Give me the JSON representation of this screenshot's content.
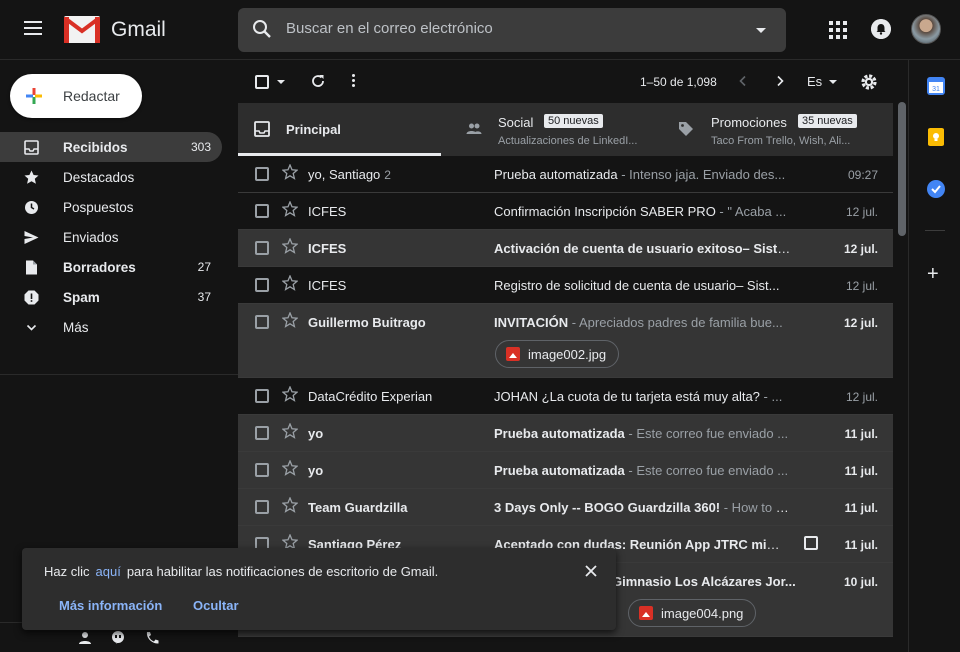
{
  "app": {
    "name": "Gmail"
  },
  "search": {
    "placeholder": "Buscar en el correo electrónico"
  },
  "compose": {
    "label": "Redactar"
  },
  "sidebar": {
    "items": [
      {
        "label": "Recibidos",
        "count": "303",
        "icon": "inbox-icon"
      },
      {
        "label": "Destacados",
        "count": "",
        "icon": "star-icon"
      },
      {
        "label": "Pospuestos",
        "count": "",
        "icon": "clock-icon"
      },
      {
        "label": "Enviados",
        "count": "",
        "icon": "send-icon"
      },
      {
        "label": "Borradores",
        "count": "27",
        "icon": "file-icon"
      },
      {
        "label": "Spam",
        "count": "37",
        "icon": "spam-icon"
      },
      {
        "label": "Más",
        "count": "",
        "icon": "chevron-down-icon"
      }
    ]
  },
  "toolbar": {
    "pager": "1–50 de 1,098",
    "lang": "Es"
  },
  "tabs": {
    "principal": {
      "label": "Principal"
    },
    "social": {
      "label": "Social",
      "badge": "50 nuevas",
      "sub": "Actualizaciones de LinkedI..."
    },
    "promos": {
      "label": "Promociones",
      "badge": "35 nuevas",
      "sub": "Taco From Trello, Wish, Ali..."
    }
  },
  "emails": [
    {
      "sender": "yo, Santiago",
      "count": "2",
      "subject": "Prueba automatizada",
      "snippet": " - Intenso jaja. Enviado des...",
      "date": "09:27"
    },
    {
      "sender": "ICFES",
      "subject": "Confirmación Inscripción SABER PRO",
      "snippet": " - \" Acaba ...",
      "date": "12 jul."
    },
    {
      "sender": "ICFES",
      "subject": "Activación de cuenta de usuario exitoso– Siste...",
      "snippet": "",
      "date": "12 jul."
    },
    {
      "sender": "ICFES",
      "subject": "Registro de solicitud de cuenta de usuario– Sist...",
      "snippet": "",
      "date": "12 jul."
    },
    {
      "sender": "Guillermo Buitrago",
      "subject": "INVITACIÓN",
      "snippet": " - Apreciados padres de familia bue...",
      "date": "12 jul.",
      "attachment": "image002.jpg"
    },
    {
      "sender": "DataCrédito Experian",
      "subject": "JOHAN ¿La cuota de tu tarjeta está muy alta?",
      "snippet": " - ...",
      "date": "12 jul."
    },
    {
      "sender": "yo",
      "subject": "Prueba automatizada",
      "snippet": " - Este correo fue enviado ...",
      "date": "11 jul."
    },
    {
      "sender": "yo",
      "subject": "Prueba automatizada",
      "snippet": " - Este correo fue enviado ...",
      "date": "11 jul."
    },
    {
      "sender": "Team Guardzilla",
      "subject": "3 Days Only -- BOGO Guardzilla 360!",
      "snippet": " - How to G...",
      "date": "11 jul."
    },
    {
      "sender": "Santiago Pérez",
      "subject": "Aceptado con dudas: Reunión App JTRC mié 11...",
      "snippet": "",
      "date": "11 jul."
    },
    {
      "sender": "",
      "subject": "Gimnasio Los Alcázares Jor...",
      "snippet": "",
      "date": "10 jul.",
      "attachment": "image004.png"
    }
  ],
  "toast": {
    "prefix": "Haz clic",
    "link": "aquí",
    "suffix": "para habilitar las notificaciones de escritorio de Gmail.",
    "more": "Más información",
    "hide": "Ocultar"
  },
  "colors": {
    "background": "#141414",
    "unread_row": "#353535",
    "link": "#8ab4f8",
    "gmail_red": "#d93025"
  }
}
